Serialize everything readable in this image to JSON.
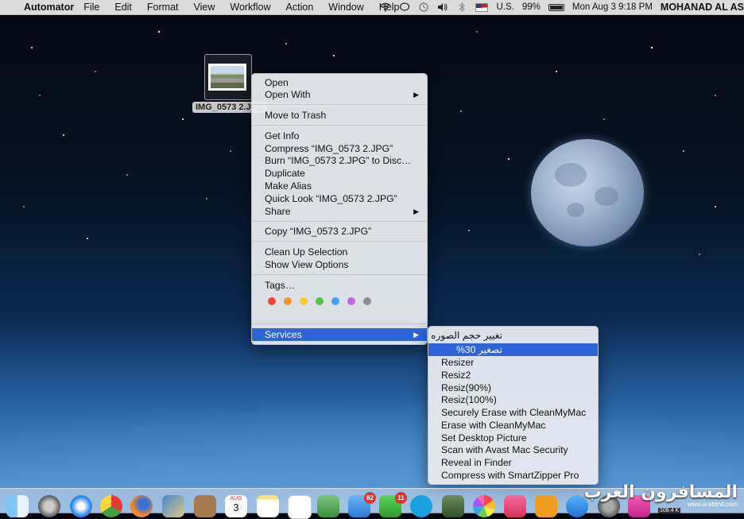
{
  "menubar": {
    "app_name": "Automator",
    "items": [
      "File",
      "Edit",
      "Format",
      "View",
      "Workflow",
      "Action",
      "Window",
      "Help"
    ],
    "input_source": "U.S.",
    "battery": "99%",
    "clock": "Mon Aug 3  9:18 PM",
    "user": "MOHANAD AL AS"
  },
  "desktop_file": {
    "label": "IMG_0573 2.JPG"
  },
  "context_menu": {
    "items": {
      "open": "Open",
      "open_with": "Open With",
      "move_to_trash": "Move to Trash",
      "get_info": "Get Info",
      "compress": "Compress “IMG_0573 2.JPG”",
      "burn": "Burn “IMG_0573 2.JPG” to Disc…",
      "duplicate": "Duplicate",
      "make_alias": "Make Alias",
      "quick_look": "Quick Look “IMG_0573 2.JPG”",
      "share": "Share",
      "copy": "Copy “IMG_0573 2.JPG”",
      "clean_up": "Clean Up Selection",
      "view_options": "Show View Options",
      "tags": "Tags…",
      "services": "Services"
    },
    "tag_colors": [
      "#f0453a",
      "#f5962a",
      "#f7cb2f",
      "#55c347",
      "#3fa4f5",
      "#c068dd",
      "#8e8e93"
    ]
  },
  "services_menu": {
    "items": [
      "تغيير حجم الصوره",
      "تصغير 30%",
      "Resizer",
      "Resiz2",
      "Resiz(90%)",
      "Resiz(100%)",
      "Securely Erase with CleanMyMac",
      "Erase with CleanMyMac",
      "Set Desktop Picture",
      "Scan with Avast Mac Security",
      "Reveal in Finder",
      "Compress with SmartZipper Pro"
    ],
    "highlighted_index": 1
  },
  "dock": {
    "calendar_month": "AUG",
    "calendar_day": "3",
    "mail_badge": "82",
    "facetime_badge": "11",
    "net_speed": "108.4 K"
  },
  "watermark": {
    "brand_ar": "المسافرون العرب",
    "url": "www.arabtrvl.com"
  },
  "colors": {
    "highlight": "#2d65d9",
    "menu_bg": "#e8ebf0"
  }
}
